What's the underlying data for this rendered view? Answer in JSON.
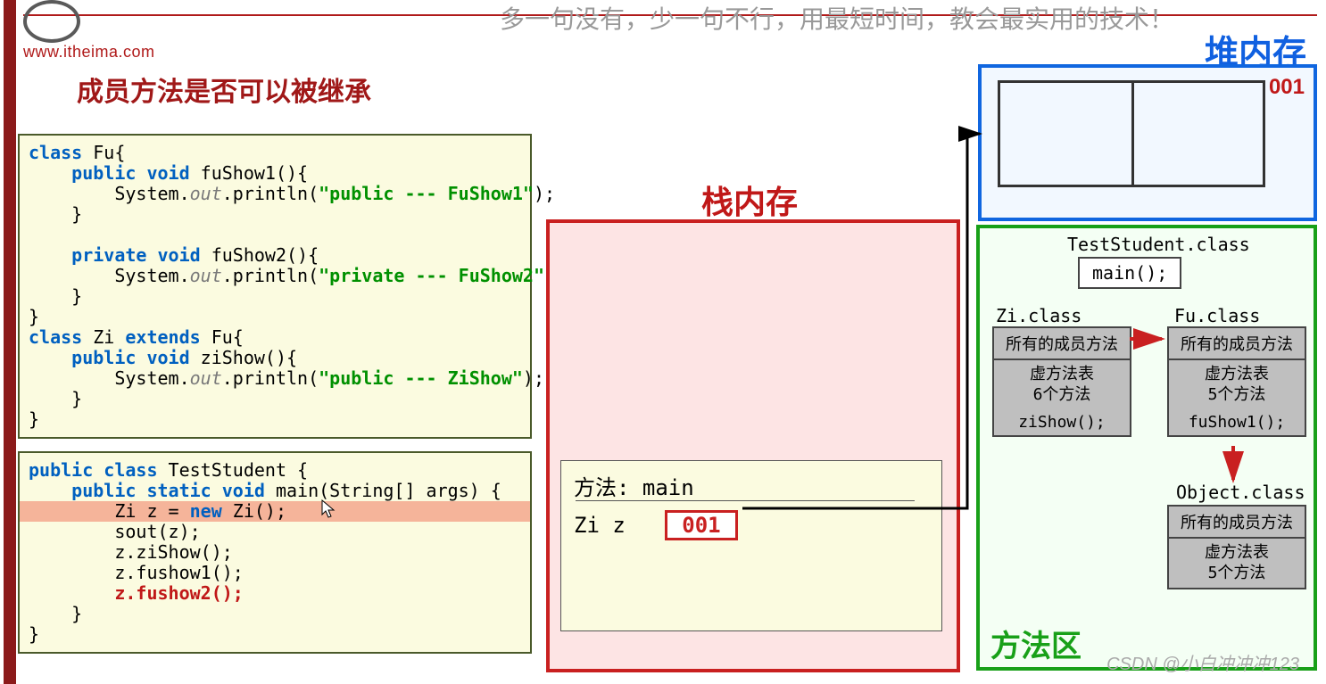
{
  "logo": {
    "cn": "",
    "url": "www.itheima.com"
  },
  "top_slogan": "多一句没有，少一句不行，用最短时间，教会最实用的技术！",
  "title": "成员方法是否可以被继承",
  "code1": [
    {
      "t": "class",
      "c": "kw"
    },
    {
      "t": " Fu{\n"
    },
    {
      "t": "    public void",
      "c": "kw"
    },
    {
      "t": " fuShow1(){\n"
    },
    {
      "t": "        System."
    },
    {
      "t": "out",
      "c": "it"
    },
    {
      "t": ".println("
    },
    {
      "t": "\"public --- FuShow1\"",
      "c": "str"
    },
    {
      "t": ");\n"
    },
    {
      "t": "    }\n"
    },
    {
      "t": "\n"
    },
    {
      "t": "    private void",
      "c": "kw"
    },
    {
      "t": " fuShow2(){\n"
    },
    {
      "t": "        System."
    },
    {
      "t": "out",
      "c": "it"
    },
    {
      "t": ".println("
    },
    {
      "t": "\"private --- FuShow2\"",
      "c": "str"
    },
    {
      "t": ");\n"
    },
    {
      "t": "    }\n"
    },
    {
      "t": "}\n"
    },
    {
      "t": "class",
      "c": "kw"
    },
    {
      "t": " Zi "
    },
    {
      "t": "extends",
      "c": "kw"
    },
    {
      "t": " Fu{\n"
    },
    {
      "t": "    public void",
      "c": "kw"
    },
    {
      "t": " ziShow(){\n"
    },
    {
      "t": "        System."
    },
    {
      "t": "out",
      "c": "it"
    },
    {
      "t": ".println("
    },
    {
      "t": "\"public --- ZiShow\"",
      "c": "str"
    },
    {
      "t": ");\n"
    },
    {
      "t": "    }\n"
    },
    {
      "t": "}\n"
    }
  ],
  "code2": [
    {
      "t": "public class",
      "c": "kw"
    },
    {
      "t": " TestStudent {\n"
    },
    {
      "t": "    public static void",
      "c": "kw"
    },
    {
      "t": " main(String[] args) {\n"
    },
    {
      "t": "        Zi z = ",
      "hl": true
    },
    {
      "t": "new",
      "c": "kw",
      "hl": true
    },
    {
      "t": " Zi();\n",
      "hl": true
    },
    {
      "t": "        sout(z);\n"
    },
    {
      "t": "        z.ziShow();\n"
    },
    {
      "t": "        z.fushow1();\n"
    },
    {
      "t": "        z.fushow2();",
      "c": "err"
    },
    {
      "t": "\n"
    },
    {
      "t": "    }\n"
    },
    {
      "t": "}\n"
    }
  ],
  "stack": {
    "label": "栈内存",
    "frame_label": "方法: main",
    "var": "Zi z",
    "addr": "001"
  },
  "heap": {
    "label": "堆内存",
    "addr": "001"
  },
  "method_area": {
    "label": "方法区",
    "test_class": "TestStudent.class",
    "main_method": "main();",
    "zi": {
      "name": "Zi.class",
      "header": "所有的成员方法",
      "body": "虚方法表\n6个方法",
      "footer": "ziShow();"
    },
    "fu": {
      "name": "Fu.class",
      "header": "所有的成员方法",
      "body": "虚方法表\n5个方法",
      "footer": "fuShow1();"
    },
    "obj": {
      "name": "Object.class",
      "header": "所有的成员方法",
      "body": "虚方法表\n5个方法"
    }
  },
  "watermark": "CSDN @小白冲冲冲123"
}
